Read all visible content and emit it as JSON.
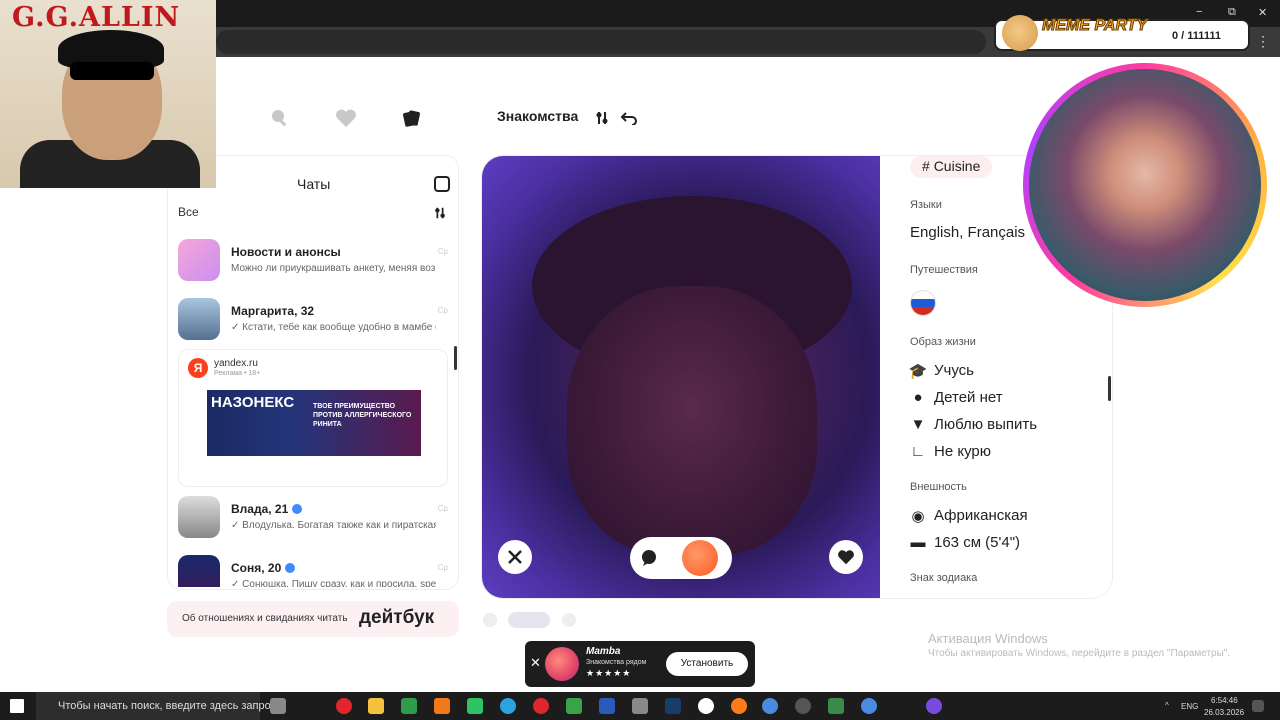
{
  "browser": {
    "window_controls": [
      "−",
      "⧉",
      "✕"
    ],
    "menu": "⋮"
  },
  "topnav": {
    "title": "Знакомства"
  },
  "chats": {
    "title": "Чаты",
    "filter": "Все",
    "items": [
      {
        "name": "Новости и анонсы",
        "message": "Можно ли приукрашивать анкету, меняя воз...",
        "time": "Ср",
        "verified": false
      },
      {
        "name": "Маргарита, 32",
        "message": "✓ Кстати, тебе как вообще удобно в мамбе о...",
        "time": "Ср",
        "verified": false
      },
      {
        "name": "Влада, 21",
        "message": "✓ Влодулька. Богатая также как и пиратская ...",
        "time": "Ср",
        "verified": true
      },
      {
        "name": "Соня, 20",
        "message": "✓ Сонюшка, Пишу сразу, как и просила, spec...",
        "time": "Ср",
        "verified": true
      }
    ],
    "ad": {
      "domain": "yandex.ru",
      "tag": "Реклама • 18+",
      "logo": "Я",
      "banner_title": "НАЗОНЕКС",
      "banner_text": "ТВОЕ ПРЕИМУЩЕСТВО ПРОТИВ АЛЛЕРГИЧЕСКОГО РИНИТА"
    }
  },
  "dating_promo": {
    "text": "Об отношениях и свиданиях читать",
    "brand": "дейтбук"
  },
  "profile": {
    "interest_tag": "Cuisine",
    "languages_label": "Языки",
    "languages_value": "English, Français",
    "travel_label": "Путешествия",
    "lifestyle_label": "Образ жизни",
    "lifestyle": [
      "Учусь",
      "Детей нет",
      "Люблю выпить",
      "Не курю"
    ],
    "appearance_label": "Внешность",
    "appearance": [
      "Африканская",
      "163 см (5'4\")"
    ],
    "zodiac_label": "Знак зодиака"
  },
  "watermark": {
    "line1": "Активация Windows",
    "line2": "Чтобы активировать Windows, перейдите в раздел \"Параметры\"."
  },
  "mamba": {
    "close": "✕",
    "name": "Mamba",
    "subtitle": "Знакомства рядом",
    "stars": "★★★★★",
    "install": "Установить"
  },
  "taskbar": {
    "search_placeholder": "Чтобы начать поиск, введите здесь запрос",
    "lang": "ENG",
    "time": "6:54:46",
    "date": "26.03.2026"
  },
  "overlays": {
    "gg_title": "G.G.ALLIN",
    "meme_label": "MEME PARTY",
    "meme_count": "0 / 111111"
  },
  "colors": {
    "accent": "#ff5a1f",
    "ad_logo": "#fc3f1d",
    "verified": "#3d8bff"
  }
}
